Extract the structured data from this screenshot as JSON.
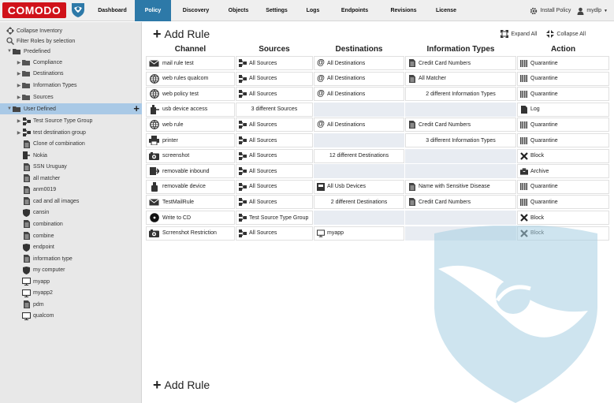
{
  "brand": {
    "logo_text": "COMODO"
  },
  "nav": {
    "items": [
      {
        "label": "Dashboard",
        "active": false
      },
      {
        "label": "Policy",
        "active": true
      },
      {
        "label": "Discovery",
        "active": false
      },
      {
        "label": "Objects",
        "active": false
      },
      {
        "label": "Settings",
        "active": false
      },
      {
        "label": "Logs",
        "active": false
      },
      {
        "label": "Endpoints",
        "active": false
      },
      {
        "label": "Revisions",
        "active": false
      },
      {
        "label": "License",
        "active": false
      }
    ],
    "install_policy": "Install Policy",
    "user": "mydlp"
  },
  "sidebar": {
    "collapse_inventory": "Collapse Inventory",
    "filter_rules": "Filter Roles by selection",
    "predefined": "Predefined",
    "predefined_children": [
      "Compliance",
      "Destinations",
      "Information Types",
      "Sources"
    ],
    "user_defined": "User Defined",
    "user_items": [
      {
        "label": "Test Source Type Group",
        "icon": "source-group-icon",
        "expandable": true
      },
      {
        "label": "test destination group",
        "icon": "source-group-icon",
        "expandable": true
      },
      {
        "label": "Clone of combination",
        "icon": "document-icon",
        "expandable": false
      },
      {
        "label": "Nokia",
        "icon": "device-icon",
        "expandable": false
      },
      {
        "label": "SSN Uruguay",
        "icon": "document-icon",
        "expandable": false
      },
      {
        "label": "all matcher",
        "icon": "document-icon",
        "expandable": false
      },
      {
        "label": "anm0019",
        "icon": "document-icon",
        "expandable": false
      },
      {
        "label": "cad and all images",
        "icon": "document-icon",
        "expandable": false
      },
      {
        "label": "cansin",
        "icon": "shield-icon",
        "expandable": false
      },
      {
        "label": "combination",
        "icon": "document-icon",
        "expandable": false
      },
      {
        "label": "combine",
        "icon": "document-icon",
        "expandable": false
      },
      {
        "label": "endpoint",
        "icon": "shield-icon",
        "expandable": false
      },
      {
        "label": "information type",
        "icon": "document-icon",
        "expandable": false
      },
      {
        "label": "my computer",
        "icon": "shield-icon",
        "expandable": false
      },
      {
        "label": "myapp",
        "icon": "monitor-icon",
        "expandable": false
      },
      {
        "label": "myapp2",
        "icon": "monitor-icon",
        "expandable": false
      },
      {
        "label": "pdm",
        "icon": "document-icon",
        "expandable": false
      },
      {
        "label": "qualcom",
        "icon": "monitor-icon",
        "expandable": false
      }
    ]
  },
  "main": {
    "add_rule": "Add Rule",
    "expand_all": "Expand All",
    "collapse_all": "Collapse All",
    "headers": {
      "channel": "Channel",
      "sources": "Sources",
      "destinations": "Destinations",
      "info_types": "Information Types",
      "action": "Action"
    },
    "rules": [
      {
        "channel": "mail rule test",
        "channel_icon": "mail-icon",
        "source": "All Sources",
        "source_icon": "source-group-icon",
        "destination": "All Destinations",
        "destination_icon": "at-icon",
        "info": "Credit Card Numbers",
        "info_icon": "document-icon",
        "action": "Quarantine",
        "action_icon": "quarantine-icon"
      },
      {
        "channel": "web rules qualcom",
        "channel_icon": "globe-icon",
        "source": "All Sources",
        "source_icon": "source-group-icon",
        "destination": "All Destinations",
        "destination_icon": "at-icon",
        "info": "All Matcher",
        "info_icon": "document-icon",
        "action": "Quarantine",
        "action_icon": "quarantine-icon"
      },
      {
        "channel": "web policy test",
        "channel_icon": "globe-icon",
        "source": "All Sources",
        "source_icon": "source-group-icon",
        "destination": "All Destinations",
        "destination_icon": "at-icon",
        "info": "2 different Information Types",
        "info_icon": "",
        "action": "Quarantine",
        "action_icon": "quarantine-icon"
      },
      {
        "channel": "usb device access",
        "channel_icon": "usb-icon",
        "source": "3 different Sources",
        "source_icon": "",
        "destination": "",
        "destination_icon": "",
        "info": "",
        "info_icon": "",
        "action": "Log",
        "action_icon": "log-icon"
      },
      {
        "channel": "web rule",
        "channel_icon": "globe-icon",
        "source": "All Sources",
        "source_icon": "source-group-icon",
        "destination": "All Destinations",
        "destination_icon": "at-icon",
        "info": "Credit Card Numbers",
        "info_icon": "document-icon",
        "action": "Quarantine",
        "action_icon": "quarantine-icon"
      },
      {
        "channel": "printer",
        "channel_icon": "printer-icon",
        "source": "All Sources",
        "source_icon": "source-group-icon",
        "destination": "",
        "destination_icon": "",
        "info": "3 different Information Types",
        "info_icon": "",
        "action": "Quarantine",
        "action_icon": "quarantine-icon"
      },
      {
        "channel": "screenshot",
        "channel_icon": "camera-icon",
        "source": "All Sources",
        "source_icon": "source-group-icon",
        "destination": "12 different Destinations",
        "destination_icon": "",
        "info": "",
        "info_icon": "",
        "action": "Block",
        "action_icon": "block-icon"
      },
      {
        "channel": "removable inbound",
        "channel_icon": "removable-icon",
        "source": "All Sources",
        "source_icon": "source-group-icon",
        "destination": "",
        "destination_icon": "",
        "info": "",
        "info_icon": "",
        "action": "Archive",
        "action_icon": "archive-icon"
      },
      {
        "channel": "removable device",
        "channel_icon": "usb-stick-icon",
        "source": "All Sources",
        "source_icon": "source-group-icon",
        "destination": "All Usb Devices",
        "destination_icon": "usb-dest-icon",
        "info": "Name with Sensitive Disease",
        "info_icon": "document-icon",
        "action": "Quarantine",
        "action_icon": "quarantine-icon"
      },
      {
        "channel": "TestMailRule",
        "channel_icon": "mail-icon",
        "source": "All Sources",
        "source_icon": "source-group-icon",
        "destination": "2 different Destinations",
        "destination_icon": "",
        "info": "Credit Card Numbers",
        "info_icon": "document-icon",
        "action": "Quarantine",
        "action_icon": "quarantine-icon"
      },
      {
        "channel": "Write to CD",
        "channel_icon": "cd-icon",
        "source": "Test Source Type Group",
        "source_icon": "source-group-icon",
        "destination": "",
        "destination_icon": "",
        "info": "",
        "info_icon": "",
        "action": "Block",
        "action_icon": "block-icon"
      },
      {
        "channel": "Scrrenshot Restriction",
        "channel_icon": "camera-icon",
        "source": "All Sources",
        "source_icon": "source-group-icon",
        "destination": "myapp",
        "destination_icon": "monitor-icon",
        "info": "",
        "info_icon": "",
        "action": "Block",
        "action_icon": "block-icon"
      }
    ]
  },
  "colors": {
    "brand_red": "#d0121a",
    "active_tab": "#2d79a8",
    "selected_row": "#a9c9e6",
    "empty_cell": "#e8ecf2",
    "watermark": "#a7cfe2"
  }
}
